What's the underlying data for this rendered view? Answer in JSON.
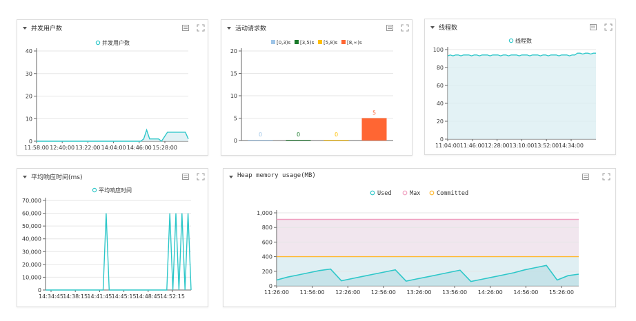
{
  "colors": {
    "teal": "#2ec7c9",
    "teal_fill": "#d9eef2",
    "red_bar": "#ff6633",
    "max_line": "#f0a0c0",
    "committed_line": "#ffb830",
    "bucket_colors": [
      "#9fc5e8",
      "#1a7a2a",
      "#ffc000",
      "#ff6633"
    ]
  },
  "icons": {
    "collapse": "chevron-down-icon",
    "table": "table-view-icon",
    "fullscreen": "fullscreen-icon"
  },
  "panels": {
    "concurrent_users": {
      "title": "并发用户数",
      "legend": "并发用户数",
      "chart_data": {
        "type": "area",
        "series": [
          {
            "name": "并发用户数",
            "values": [
              0,
              0,
              0,
              0,
              0,
              0,
              0,
              0,
              0,
              0,
              0,
              0,
              0,
              0,
              0,
              0,
              0,
              0,
              0,
              0,
              0,
              0,
              0,
              0,
              0,
              0,
              0,
              0,
              0,
              0,
              0,
              0,
              0,
              0,
              0,
              0,
              1,
              5,
              1,
              1,
              1,
              1,
              0,
              2,
              4,
              4,
              4,
              4,
              4,
              4,
              4,
              1
            ]
          }
        ],
        "x_ticks": [
          "11:58:00",
          "12:40:00",
          "13:22:00",
          "14:04:00",
          "14:46:00",
          "15:28:00"
        ],
        "ylim": [
          0,
          40
        ],
        "y_ticks": [
          0,
          10,
          20,
          30,
          40
        ]
      }
    },
    "active_requests": {
      "title": "活动请求数",
      "legend": [
        "[0,3)s",
        "[3,5)s",
        "[5,8)s",
        "[8,∞)s"
      ],
      "chart_data": {
        "type": "bar",
        "categories": [
          "[0,3)s",
          "[3,5)s",
          "[5,8)s",
          "[8,∞)s"
        ],
        "values": [
          0,
          0,
          0,
          5
        ],
        "value_labels": [
          "0",
          "0",
          "0",
          "5"
        ],
        "ylim": [
          0,
          20
        ],
        "y_ticks": [
          0,
          5,
          10,
          15,
          20
        ]
      }
    },
    "threads": {
      "title": "线程数",
      "legend": "线程数",
      "chart_data": {
        "type": "area",
        "series": [
          {
            "name": "线程数",
            "values": [
              93,
              94,
              93,
              94,
              94,
              93,
              94,
              94,
              94,
              93,
              94,
              94,
              93,
              94,
              94,
              94,
              93,
              94,
              94,
              94,
              93,
              94,
              94,
              93,
              94,
              94,
              94,
              93,
              94,
              94,
              94,
              93,
              94,
              94,
              94,
              93,
              94,
              94,
              93,
              94,
              94,
              94,
              93,
              94,
              94,
              94,
              93,
              94,
              94,
              96,
              96,
              95,
              96,
              96,
              95,
              96,
              96
            ]
          }
        ],
        "x_ticks": [
          "11:04:00",
          "11:46:00",
          "12:28:00",
          "13:10:00",
          "13:52:00",
          "14:34:00"
        ],
        "ylim": [
          0,
          100
        ],
        "y_ticks": [
          0,
          20,
          40,
          60,
          80,
          100
        ]
      }
    },
    "avg_response": {
      "title": "平均响应时间(ms)",
      "legend": "平均响应时间",
      "chart_data": {
        "type": "line",
        "series": [
          {
            "name": "平均响应时间",
            "values": [
              0,
              0,
              0,
              0,
              0,
              0,
              0,
              0,
              0,
              0,
              0,
              0,
              0,
              0,
              0,
              0,
              0,
              0,
              0,
              0,
              60000,
              0,
              0,
              0,
              0,
              0,
              0,
              0,
              0,
              0,
              0,
              0,
              0,
              0,
              0,
              0,
              0,
              0,
              0,
              0,
              0,
              60000,
              0,
              60000,
              0,
              60000,
              0,
              60000,
              0
            ]
          }
        ],
        "x_ticks": [
          "14:34:45",
          "14:38:15",
          "14:41:45",
          "14:45:15",
          "14:48:45",
          "14:52:15"
        ],
        "ylim": [
          0,
          70000
        ],
        "y_ticks": [
          "0",
          "10,000",
          "20,000",
          "30,000",
          "40,000",
          "50,000",
          "60,000",
          "70,000"
        ]
      }
    },
    "heap_memory": {
      "title": "Heap memory usage(MB)",
      "legend": [
        "Used",
        "Max",
        "Committed"
      ],
      "chart_data": {
        "type": "area",
        "x_ticks": [
          "11:26:00",
          "11:56:00",
          "12:26:00",
          "12:56:00",
          "13:26:00",
          "13:56:00",
          "14:26:00",
          "14:56:00",
          "15:26:00"
        ],
        "ylim": [
          0,
          1000
        ],
        "y_ticks": [
          "0",
          "200",
          "400",
          "600",
          "800",
          "1,000"
        ],
        "series": [
          {
            "name": "Used",
            "values": [
              80,
              120,
              150,
              180,
              210,
              230,
              70,
              100,
              130,
              160,
              190,
              220,
              65,
              95,
              125,
              155,
              185,
              215,
              60,
              90,
              120,
              150,
              180,
              220,
              250,
              280,
              80,
              140,
              160
            ]
          },
          {
            "name": "Max",
            "values": [
              910,
              910
            ]
          },
          {
            "name": "Committed",
            "values": [
              400,
              400
            ]
          }
        ]
      }
    }
  }
}
